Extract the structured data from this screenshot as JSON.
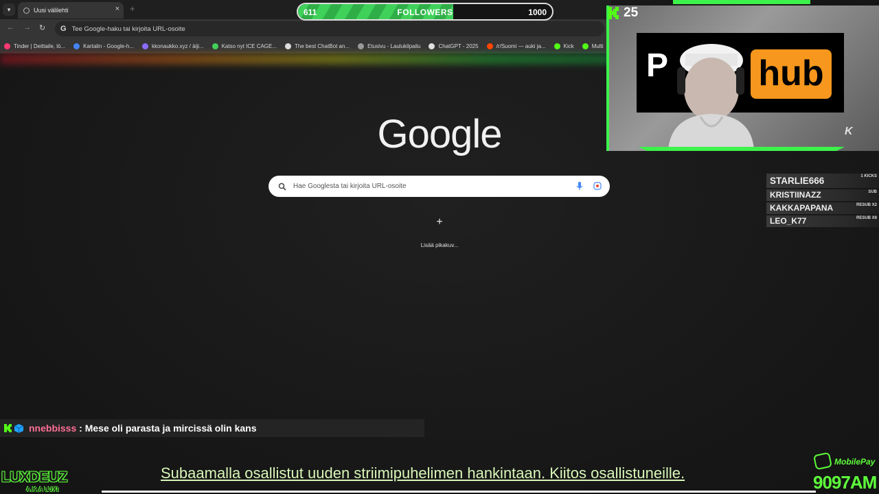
{
  "browser": {
    "tab_title": "Uusi välilehti",
    "tab_close": "×",
    "new_tab": "+",
    "address_placeholder": "Tee Google-haku tai kirjoita URL-osoite",
    "bookmarks": [
      {
        "label": "Tinder | Deittaile, lö...",
        "color": "#fd3a73"
      },
      {
        "label": "Kartalin - Google-h...",
        "color": "#4285f4"
      },
      {
        "label": "kkonaukko.xyz / äiji...",
        "color": "#8a6cff"
      },
      {
        "label": "Katso nyt ICE CAGE...",
        "color": "#3fd15a"
      },
      {
        "label": "The best ChatBot an...",
        "color": "#dddddd"
      },
      {
        "label": "Etusivu - Laulukilpailu",
        "color": "#9a9a9a"
      },
      {
        "label": "ChatGPT - 2025",
        "color": "#e0e0e0"
      },
      {
        "label": "/r/Suomi — auki ja...",
        "color": "#ff4500"
      },
      {
        "label": "Kick",
        "color": "#53fc18"
      },
      {
        "label": "Multi",
        "color": "#53fc18"
      }
    ]
  },
  "ntp": {
    "logo": "Google",
    "search_placeholder": "Hae Googlesta tai kirjoita URL-osoite",
    "add_shortcut_icon": "+",
    "add_shortcut_label": "Lisää pikakuv..."
  },
  "follower_goal": {
    "current": "611",
    "label": "FOLLOWERS",
    "target": "1000",
    "progress_fraction": 0.611
  },
  "webcam": {
    "viewer_count": "25",
    "poster_left": "P",
    "poster_right": "hub",
    "watermark": "K"
  },
  "recent_events": [
    {
      "name": "STARLIE666",
      "tag": "1 KICKS"
    },
    {
      "name": "KRISTIINAZZ",
      "tag": "SUB"
    },
    {
      "name": "KAKKAPAPANA",
      "tag": "RESUB X2"
    },
    {
      "name": "LEO_K77",
      "tag": "RESUB X8"
    }
  ],
  "chat": {
    "user": "nnebbisss",
    "separator": " : ",
    "message": "Mese oli parasta ja mircissä olin kans"
  },
  "ticker": "Subaamalla osallistut uuden striimipuhelimen hankintaan. Kiitos osallistuneille.",
  "branding": {
    "name": "LUXDEUZ",
    "sub": "A.K.A LUXI",
    "mobilepay_label": "MobilePay",
    "mobilepay_code": "9097AM"
  },
  "colors": {
    "accent_green": "#3df24a",
    "chat_user": "#ff6e96",
    "ticker_text": "#d8f7b8"
  }
}
